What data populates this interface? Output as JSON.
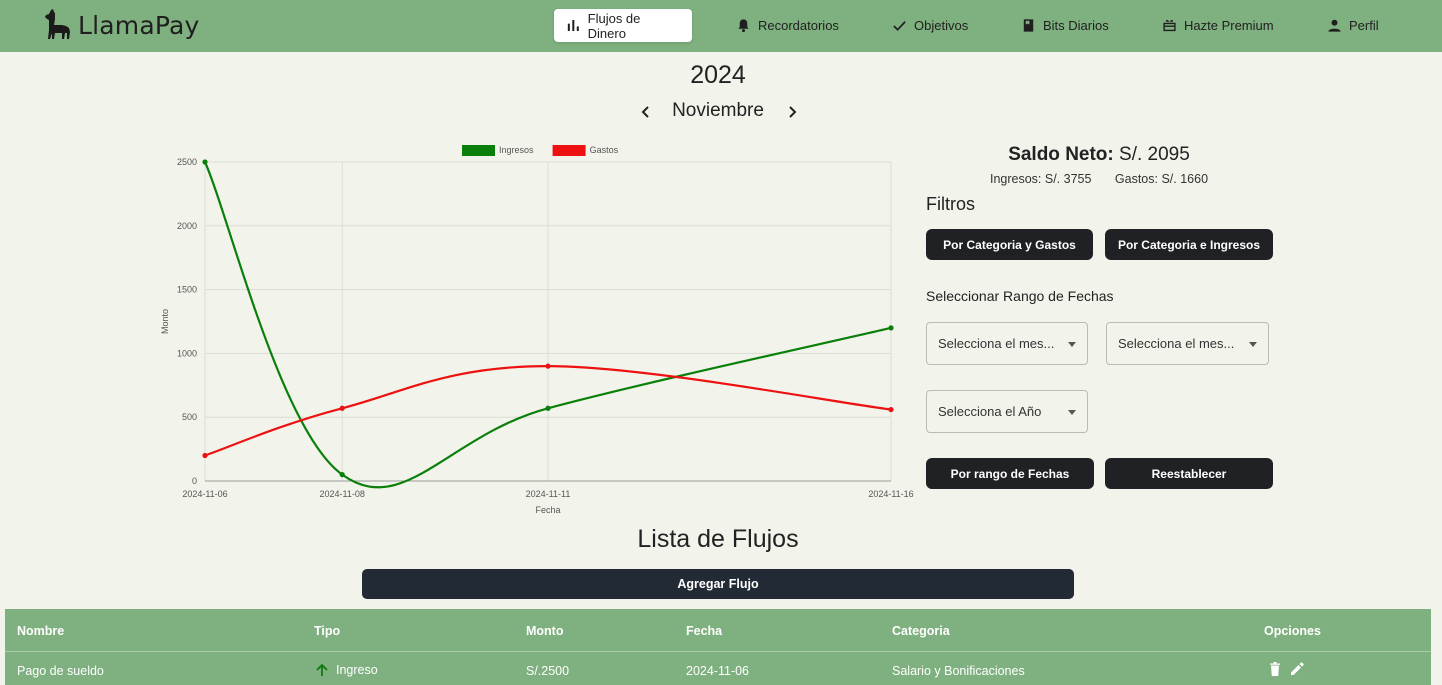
{
  "brand": {
    "name": "LlamaPay"
  },
  "nav": [
    {
      "label": "Flujos de Dinero",
      "icon": "bar-chart-icon",
      "active": true
    },
    {
      "label": "Recordatorios",
      "icon": "bell-icon"
    },
    {
      "label": "Objetivos",
      "icon": "check-icon"
    },
    {
      "label": "Bits Diarios",
      "icon": "book-icon"
    },
    {
      "label": "Hazte Premium",
      "icon": "gift-icon"
    },
    {
      "label": "Perfil",
      "icon": "user-icon"
    }
  ],
  "header": {
    "year": "2024",
    "month": "Noviembre"
  },
  "chart_data": {
    "type": "line",
    "x": [
      "2024-11-06",
      "2024-11-08",
      "2024-11-11",
      "2024-11-16"
    ],
    "series": [
      {
        "name": "Ingresos",
        "values": [
          2500,
          50,
          570,
          1200
        ],
        "color": "#0a7f0a"
      },
      {
        "name": "Gastos",
        "values": [
          200,
          570,
          900,
          560
        ],
        "color": "#ee1111"
      }
    ],
    "xlabel": "Fecha",
    "ylabel": "Monto",
    "yticks": [
      "0",
      "500",
      "1000",
      "1500",
      "2000",
      "2500"
    ],
    "ylim": [
      0,
      2500
    ],
    "grid": true,
    "legend": "top-center"
  },
  "summary": {
    "saldo_label": "Saldo Neto:",
    "saldo_value": "S/. 2095",
    "ingresos": "Ingresos: S/. 3755",
    "gastos": "Gastos: S/. 1660"
  },
  "filters": {
    "title": "Filtros",
    "btn_cat_gastos": "Por Categoria y Gastos",
    "btn_cat_ingresos": "Por Categoria e Ingresos",
    "range_title": "Seleccionar Rango de Fechas",
    "select_month_1": "Selecciona el mes...",
    "select_month_2": "Selecciona el mes...",
    "select_year": "Selecciona el Año",
    "btn_range": "Por rango de Fechas",
    "btn_reset": "Reestablecer"
  },
  "list": {
    "title": "Lista de Flujos",
    "add_button": "Agregar Flujo",
    "columns": [
      "Nombre",
      "Tipo",
      "Monto",
      "Fecha",
      "Categoria",
      "Opciones"
    ],
    "rows": [
      {
        "nombre": "Pago de sueldo",
        "tipo": "Ingreso",
        "monto": "S/.2500",
        "fecha": "2024-11-06",
        "categoria": "Salario y Bonificaciones"
      }
    ]
  }
}
